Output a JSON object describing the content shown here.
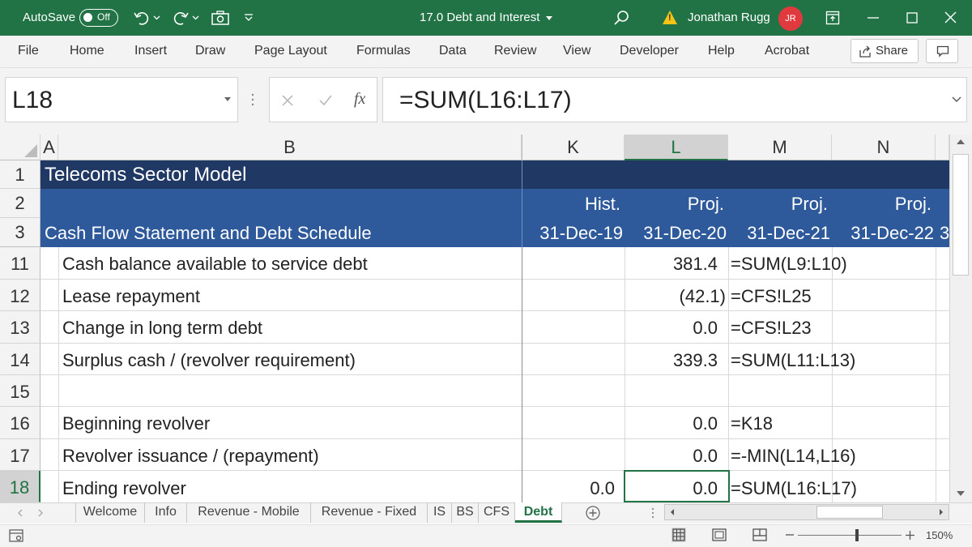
{
  "titlebar": {
    "autosave_label": "AutoSave",
    "autosave_state": "Off",
    "doc_title": "17.0 Debt and Interest",
    "user_name": "Jonathan Rugg",
    "user_initials": "JR",
    "accent": "#217346"
  },
  "ribbon": {
    "tabs": [
      "File",
      "Home",
      "Insert",
      "Draw",
      "Page Layout",
      "Formulas",
      "Data",
      "Review",
      "View",
      "Developer",
      "Help",
      "Acrobat"
    ],
    "share_label": "Share"
  },
  "formula_bar": {
    "name_box": "L18",
    "fx_label": "fx",
    "formula": "=SUM(L16:L17)"
  },
  "grid": {
    "columns": [
      "A",
      "B",
      "K",
      "L",
      "M",
      "N"
    ],
    "rows": [
      "1",
      "2",
      "3",
      "11",
      "12",
      "13",
      "14",
      "15",
      "16",
      "17",
      "18"
    ],
    "title": "Telecoms Sector Model",
    "subtitle": "Cash Flow Statement and Debt Schedule",
    "period_types": [
      "Hist.",
      "Proj.",
      "Proj.",
      "Proj."
    ],
    "period_dates": [
      "31-Dec-19",
      "31-Dec-20",
      "31-Dec-21",
      "31-Dec-22"
    ],
    "overflow_char": "3",
    "labels": [
      "Cash balance available to service debt",
      "Lease repayment",
      "Change in long term debt",
      "Surplus cash / (revolver requirement)",
      "",
      "Beginning revolver",
      "Revolver issuance / (repayment)",
      "Ending revolver"
    ],
    "k_values": [
      "",
      "",
      "",
      "",
      "",
      "",
      "",
      "0.0"
    ],
    "l_values": [
      "381.4",
      "(42.1)",
      "0.0",
      "339.3",
      "",
      "0.0",
      "0.0",
      "0.0"
    ],
    "m_formulas": [
      "=SUM(L9:L10)",
      "=CFS!L25",
      "=CFS!L23",
      "=SUM(L11:L13)",
      "",
      "=K18",
      "=-MIN(L14,L16)",
      "=SUM(L16:L17)"
    ],
    "band_dark": "#1f3864",
    "band_mid": "#2e5a9c"
  },
  "sheet_tabs": {
    "tabs": [
      "Welcome",
      "Info",
      "Revenue - Mobile",
      "Revenue - Fixed",
      "IS",
      "BS",
      "CFS",
      "Debt"
    ],
    "active": "Debt"
  },
  "statusbar": {
    "zoom": "150%"
  }
}
